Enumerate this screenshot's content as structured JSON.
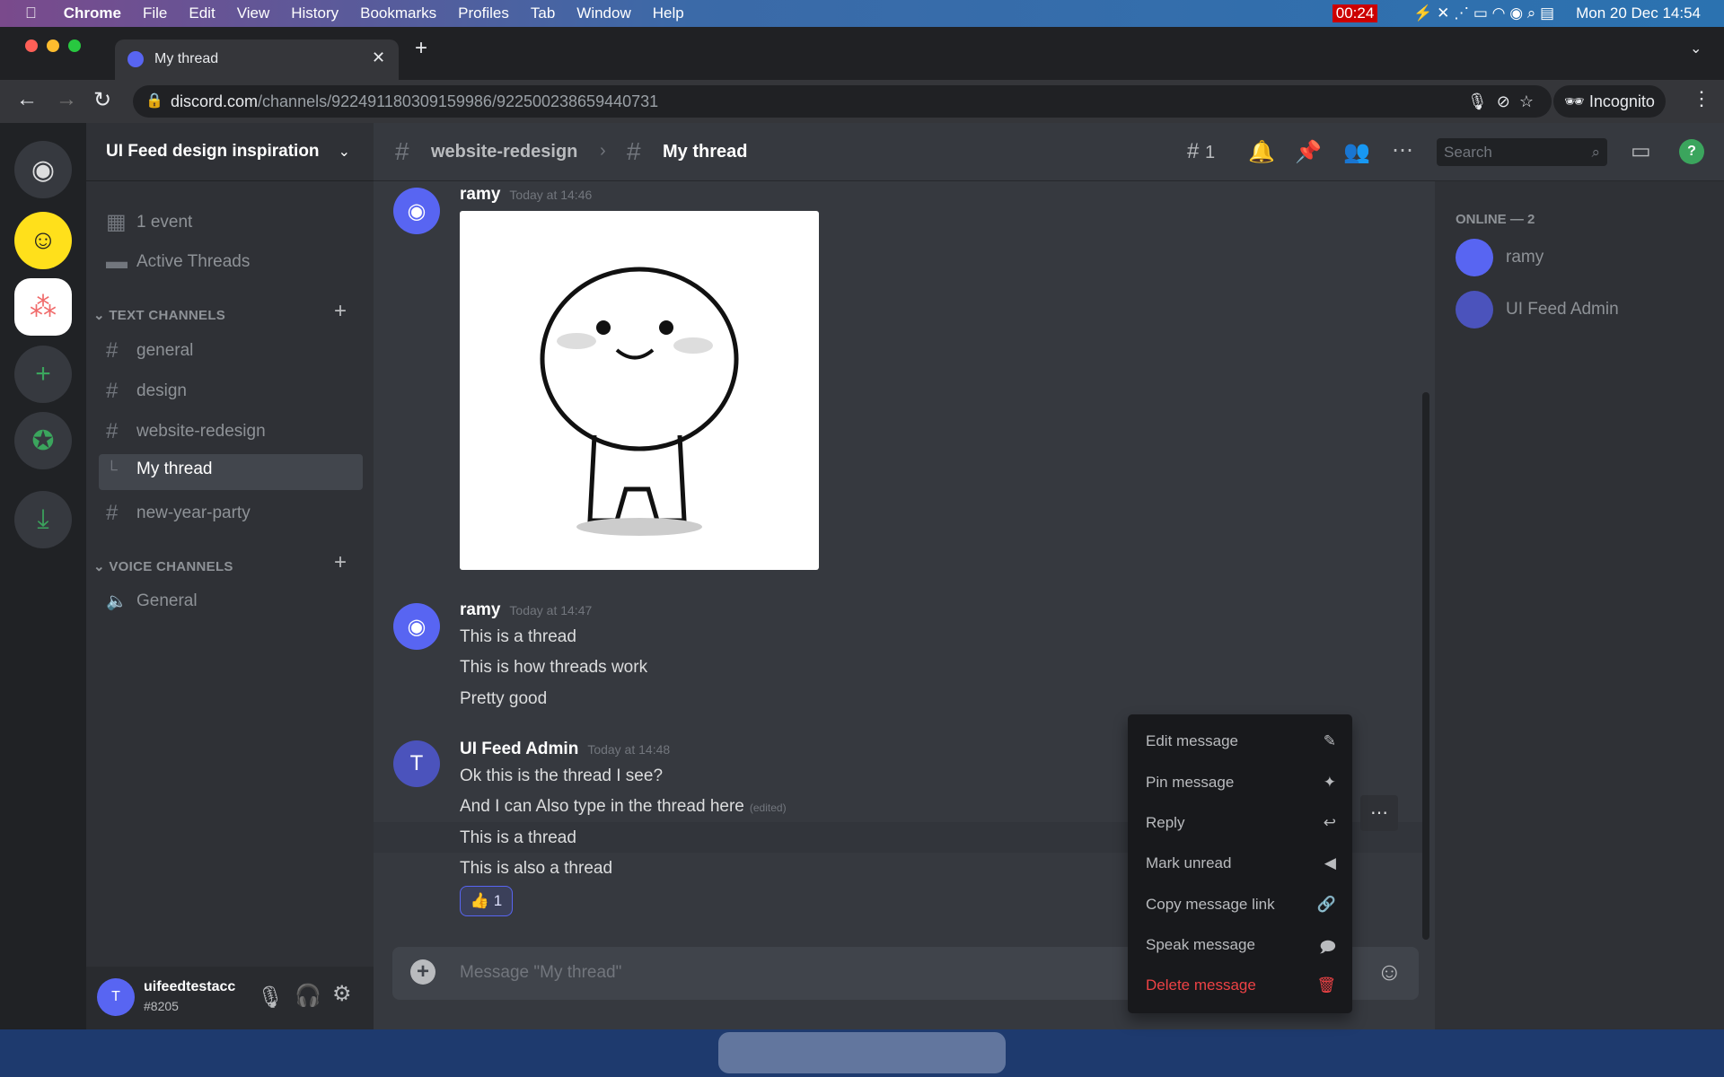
{
  "menubar": {
    "items": [
      "Chrome",
      "File",
      "Edit",
      "View",
      "History",
      "Bookmarks",
      "Profiles",
      "Tab",
      "Window",
      "Help"
    ],
    "timer": "00:24",
    "clock": "Mon 20 Dec  14:54"
  },
  "browser": {
    "tab_title": "My thread",
    "url_host": "discord.com",
    "url_path": "/channels/922491180309159986/922500238659440731",
    "profile": "Incognito"
  },
  "server": {
    "name": "UI Feed design inspiration"
  },
  "sidebar": {
    "events": "1 event",
    "active_threads": "Active Threads",
    "text_category": "TEXT CHANNELS",
    "voice_category": "VOICE CHANNELS",
    "channels": [
      "general",
      "design",
      "website-redesign",
      "My thread",
      "new-year-party"
    ],
    "voice": [
      "General"
    ]
  },
  "user": {
    "name": "uifeedtestacc",
    "tag": "#8205"
  },
  "header": {
    "parent_channel": "website-redesign",
    "thread": "My thread",
    "threads_count": "1",
    "search_placeholder": "Search"
  },
  "messages": [
    {
      "author": "ramy",
      "time": "Today at 14:46",
      "lines": []
    },
    {
      "author": "ramy",
      "time": "Today at 14:47",
      "lines": [
        "This is a thread",
        "This is how threads work",
        "Pretty good"
      ]
    },
    {
      "author": "UI Feed Admin",
      "time": "Today at 14:48",
      "lines": [
        "Ok this is the thread I see?",
        "And I can Also type in the thread here",
        "This is a thread",
        "This is also a thread"
      ],
      "edited": "(edited)",
      "reaction": {
        "emoji": "👍",
        "count": "1"
      }
    }
  ],
  "composer": {
    "placeholder": "Message \"My thread\""
  },
  "members": {
    "heading": "ONLINE — 2",
    "list": [
      "ramy",
      "UI Feed Admin"
    ]
  },
  "context_menu": {
    "items": [
      "Edit message",
      "Pin message",
      "Reply",
      "Mark unread",
      "Copy message link",
      "Speak message",
      "Delete message"
    ],
    "danger_color": "#ed4245"
  },
  "colors": {
    "blurple": "#5865f2",
    "online": "#3ba55d"
  }
}
